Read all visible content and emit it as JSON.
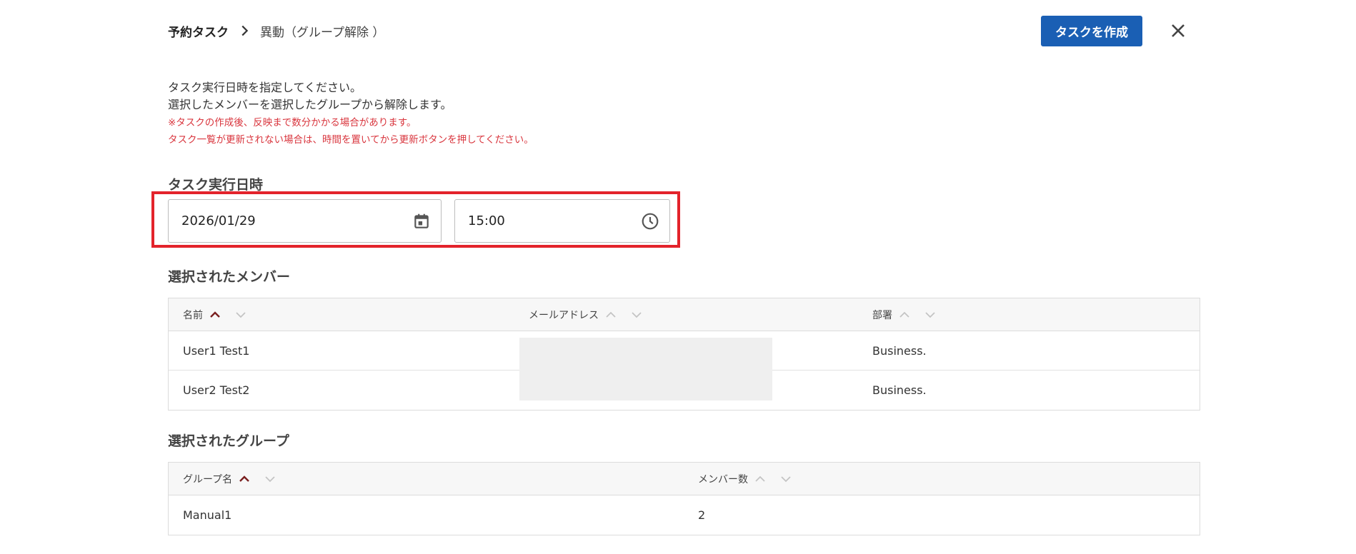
{
  "header": {
    "breadcrumb_root": "予約タスク",
    "breadcrumb_current": "異動（グループ解除 ）",
    "create_button_label": "タスクを作成",
    "close_icon": "close-icon"
  },
  "instructions": {
    "line1": "タスク実行日時を指定してください。",
    "line2": "選択したメンバーを選択したグループから解除します。",
    "note1": "※タスクの作成後、反映まで数分かかる場合があります。",
    "note2": "タスク一覧が更新されない場合は、時間を置いてから更新ボタンを押してください。",
    "note_color": "#d9363e"
  },
  "schedule": {
    "title": "タスク実行日時",
    "date_value": "2026/01/29",
    "time_value": "15:00",
    "date_icon": "calendar-icon",
    "time_icon": "clock-icon",
    "highlight_color": "#e3232b"
  },
  "members": {
    "title": "選択されたメンバー",
    "columns": [
      "名前",
      "メールアドレス",
      "部署"
    ],
    "rows": [
      {
        "name": "User1 Test1",
        "email": "",
        "department": "Business."
      },
      {
        "name": "User2 Test2",
        "email": "",
        "department": "Business."
      }
    ]
  },
  "groups": {
    "title": "選択されたグループ",
    "columns": [
      "グループ名",
      "メンバー数"
    ],
    "rows": [
      {
        "name": "Manual1",
        "member_count": "2"
      }
    ]
  },
  "colors": {
    "primary_button": "#1a5fb4",
    "sort_active": "#7a1f1f",
    "sort_inactive": "#c4c4c4"
  }
}
